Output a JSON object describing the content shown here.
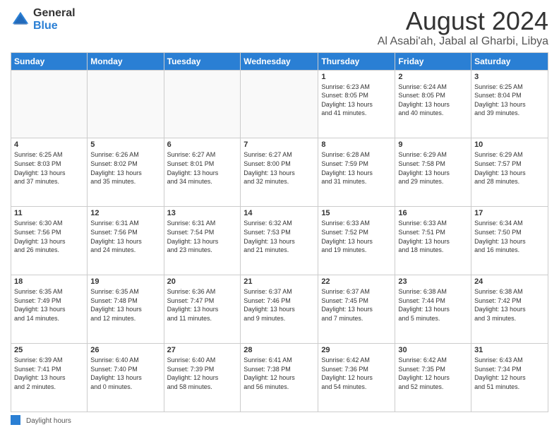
{
  "logo": {
    "line1": "General",
    "line2": "Blue"
  },
  "title": "August 2024",
  "location": "Al Asabi'ah, Jabal al Gharbi, Libya",
  "days_of_week": [
    "Sunday",
    "Monday",
    "Tuesday",
    "Wednesday",
    "Thursday",
    "Friday",
    "Saturday"
  ],
  "weeks": [
    [
      {
        "day": "",
        "info": ""
      },
      {
        "day": "",
        "info": ""
      },
      {
        "day": "",
        "info": ""
      },
      {
        "day": "",
        "info": ""
      },
      {
        "day": "1",
        "info": "Sunrise: 6:23 AM\nSunset: 8:05 PM\nDaylight: 13 hours\nand 41 minutes."
      },
      {
        "day": "2",
        "info": "Sunrise: 6:24 AM\nSunset: 8:05 PM\nDaylight: 13 hours\nand 40 minutes."
      },
      {
        "day": "3",
        "info": "Sunrise: 6:25 AM\nSunset: 8:04 PM\nDaylight: 13 hours\nand 39 minutes."
      }
    ],
    [
      {
        "day": "4",
        "info": "Sunrise: 6:25 AM\nSunset: 8:03 PM\nDaylight: 13 hours\nand 37 minutes."
      },
      {
        "day": "5",
        "info": "Sunrise: 6:26 AM\nSunset: 8:02 PM\nDaylight: 13 hours\nand 35 minutes."
      },
      {
        "day": "6",
        "info": "Sunrise: 6:27 AM\nSunset: 8:01 PM\nDaylight: 13 hours\nand 34 minutes."
      },
      {
        "day": "7",
        "info": "Sunrise: 6:27 AM\nSunset: 8:00 PM\nDaylight: 13 hours\nand 32 minutes."
      },
      {
        "day": "8",
        "info": "Sunrise: 6:28 AM\nSunset: 7:59 PM\nDaylight: 13 hours\nand 31 minutes."
      },
      {
        "day": "9",
        "info": "Sunrise: 6:29 AM\nSunset: 7:58 PM\nDaylight: 13 hours\nand 29 minutes."
      },
      {
        "day": "10",
        "info": "Sunrise: 6:29 AM\nSunset: 7:57 PM\nDaylight: 13 hours\nand 28 minutes."
      }
    ],
    [
      {
        "day": "11",
        "info": "Sunrise: 6:30 AM\nSunset: 7:56 PM\nDaylight: 13 hours\nand 26 minutes."
      },
      {
        "day": "12",
        "info": "Sunrise: 6:31 AM\nSunset: 7:56 PM\nDaylight: 13 hours\nand 24 minutes."
      },
      {
        "day": "13",
        "info": "Sunrise: 6:31 AM\nSunset: 7:54 PM\nDaylight: 13 hours\nand 23 minutes."
      },
      {
        "day": "14",
        "info": "Sunrise: 6:32 AM\nSunset: 7:53 PM\nDaylight: 13 hours\nand 21 minutes."
      },
      {
        "day": "15",
        "info": "Sunrise: 6:33 AM\nSunset: 7:52 PM\nDaylight: 13 hours\nand 19 minutes."
      },
      {
        "day": "16",
        "info": "Sunrise: 6:33 AM\nSunset: 7:51 PM\nDaylight: 13 hours\nand 18 minutes."
      },
      {
        "day": "17",
        "info": "Sunrise: 6:34 AM\nSunset: 7:50 PM\nDaylight: 13 hours\nand 16 minutes."
      }
    ],
    [
      {
        "day": "18",
        "info": "Sunrise: 6:35 AM\nSunset: 7:49 PM\nDaylight: 13 hours\nand 14 minutes."
      },
      {
        "day": "19",
        "info": "Sunrise: 6:35 AM\nSunset: 7:48 PM\nDaylight: 13 hours\nand 12 minutes."
      },
      {
        "day": "20",
        "info": "Sunrise: 6:36 AM\nSunset: 7:47 PM\nDaylight: 13 hours\nand 11 minutes."
      },
      {
        "day": "21",
        "info": "Sunrise: 6:37 AM\nSunset: 7:46 PM\nDaylight: 13 hours\nand 9 minutes."
      },
      {
        "day": "22",
        "info": "Sunrise: 6:37 AM\nSunset: 7:45 PM\nDaylight: 13 hours\nand 7 minutes."
      },
      {
        "day": "23",
        "info": "Sunrise: 6:38 AM\nSunset: 7:44 PM\nDaylight: 13 hours\nand 5 minutes."
      },
      {
        "day": "24",
        "info": "Sunrise: 6:38 AM\nSunset: 7:42 PM\nDaylight: 13 hours\nand 3 minutes."
      }
    ],
    [
      {
        "day": "25",
        "info": "Sunrise: 6:39 AM\nSunset: 7:41 PM\nDaylight: 13 hours\nand 2 minutes."
      },
      {
        "day": "26",
        "info": "Sunrise: 6:40 AM\nSunset: 7:40 PM\nDaylight: 13 hours\nand 0 minutes."
      },
      {
        "day": "27",
        "info": "Sunrise: 6:40 AM\nSunset: 7:39 PM\nDaylight: 12 hours\nand 58 minutes."
      },
      {
        "day": "28",
        "info": "Sunrise: 6:41 AM\nSunset: 7:38 PM\nDaylight: 12 hours\nand 56 minutes."
      },
      {
        "day": "29",
        "info": "Sunrise: 6:42 AM\nSunset: 7:36 PM\nDaylight: 12 hours\nand 54 minutes."
      },
      {
        "day": "30",
        "info": "Sunrise: 6:42 AM\nSunset: 7:35 PM\nDaylight: 12 hours\nand 52 minutes."
      },
      {
        "day": "31",
        "info": "Sunrise: 6:43 AM\nSunset: 7:34 PM\nDaylight: 12 hours\nand 51 minutes."
      }
    ]
  ],
  "footer": {
    "daylight_label": "Daylight hours"
  },
  "colors": {
    "header_bg": "#2a7fd4",
    "header_text": "#ffffff",
    "accent_blue": "#1a6abf"
  }
}
